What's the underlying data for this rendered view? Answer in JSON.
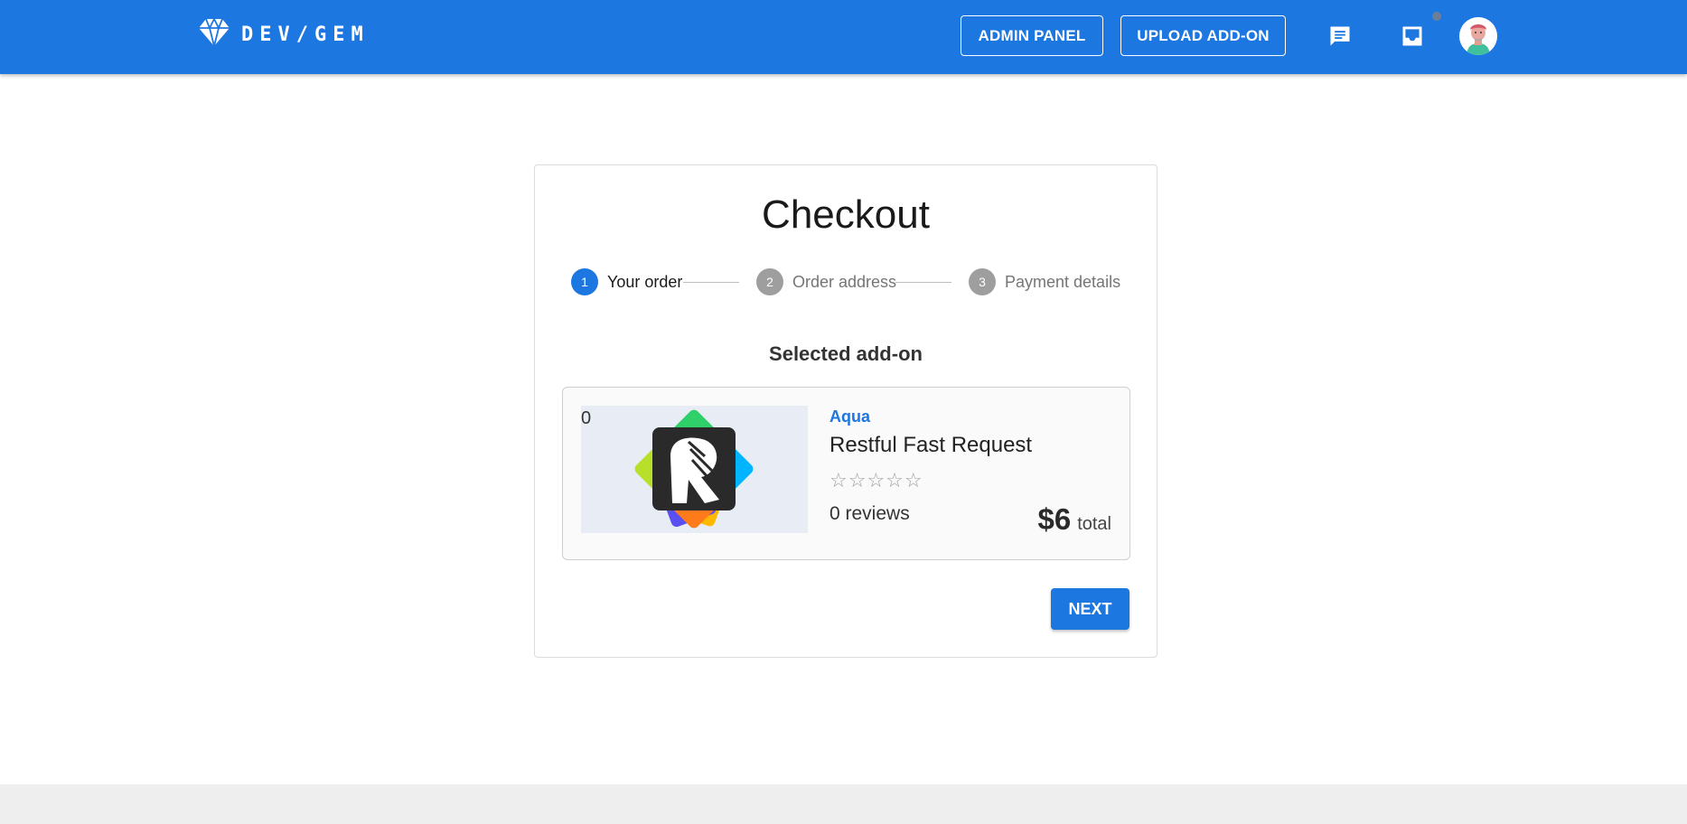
{
  "header": {
    "brand": "DEV/GEM",
    "admin_panel_label": "ADMIN PANEL",
    "upload_addon_label": "UPLOAD ADD-ON",
    "icons": [
      "diamond-icon",
      "chat-icon",
      "inbox-icon",
      "avatar"
    ],
    "accent_color": "#1d77e0"
  },
  "checkout": {
    "title": "Checkout",
    "steps": [
      {
        "number": "1",
        "label": "Your order",
        "state": "active"
      },
      {
        "number": "2",
        "label": "Order address",
        "state": "inactive"
      },
      {
        "number": "3",
        "label": "Payment details",
        "state": "inactive"
      }
    ],
    "section_title": "Selected add-on",
    "item": {
      "count": "0",
      "vendor": "Aqua",
      "name": "Restful Fast Request",
      "stars": "☆☆☆☆☆",
      "rating": 0,
      "reviews": "0 reviews",
      "price": "$6",
      "price_suffix": "total"
    },
    "next_label": "NEXT"
  }
}
